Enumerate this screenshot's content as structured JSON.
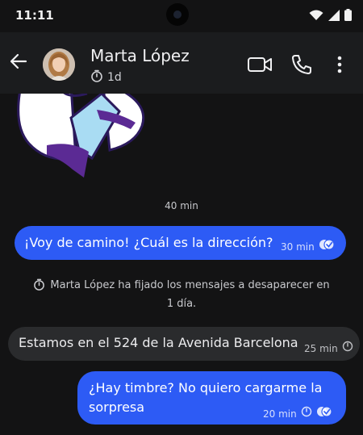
{
  "status_bar": {
    "time": "11:11"
  },
  "header": {
    "contact_name": "Marta López",
    "disappearing_timer": "1d",
    "back_icon": "arrow-left-icon",
    "video_icon": "video-camera-icon",
    "call_icon": "phone-icon",
    "menu_icon": "more-vertical-icon"
  },
  "chat": {
    "sticker_time": "40 min",
    "messages": [
      {
        "direction": "out",
        "text": "¡Voy de camino! ¿Cuál es la dirección?",
        "time": "30 min",
        "status": "read"
      },
      {
        "direction": "in",
        "text": "Estamos en el 524 de la Avenida Barcelona",
        "time": "25 min"
      },
      {
        "direction": "out",
        "line1": "¿Hay timbre? No quiero cargarme la",
        "line2": "sorpresa",
        "time": "20 min",
        "status": "read"
      }
    ],
    "system_note": {
      "line1": "Marta López ha fijado los mensajes a desaparecer en",
      "line2": "1 día."
    }
  },
  "colors": {
    "background": "#131314",
    "header": "#1b1c1e",
    "outgoing_bubble": "#2d5bf5",
    "incoming_bubble": "#2a2b2d"
  }
}
